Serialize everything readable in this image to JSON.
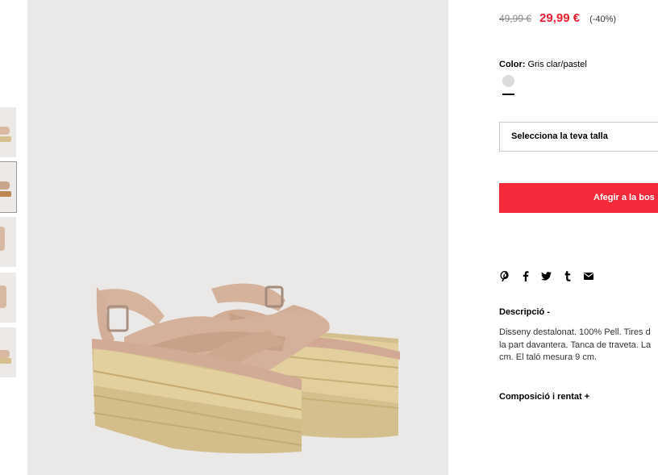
{
  "price": {
    "old": "49,99 €",
    "new": "29,99 €",
    "discount": "(-40%)"
  },
  "color": {
    "label": "Color:",
    "value": "Gris clar/pastel",
    "swatch": "#dcdcdc"
  },
  "size": {
    "placeholder": "Selecciona la teva talla"
  },
  "cart": {
    "add_label": "Afegir a la bos",
    "button_color": "#f42a3a"
  },
  "share_icons": [
    "pinterest-icon",
    "facebook-icon",
    "twitter-icon",
    "tumblr-icon",
    "email-icon"
  ],
  "description": {
    "title": "Descripció  -",
    "lines": [
      "Disseny destalonat. 100% Pell. Tires d",
      "la part davantera. Tanca de traveta. La",
      "cm. El taló mesura 9 cm."
    ]
  },
  "composition": {
    "title": "Composició i rentat  +"
  },
  "thumbnails": [
    "thumb-1",
    "thumb-2",
    "thumb-3",
    "thumb-4",
    "thumb-5"
  ]
}
